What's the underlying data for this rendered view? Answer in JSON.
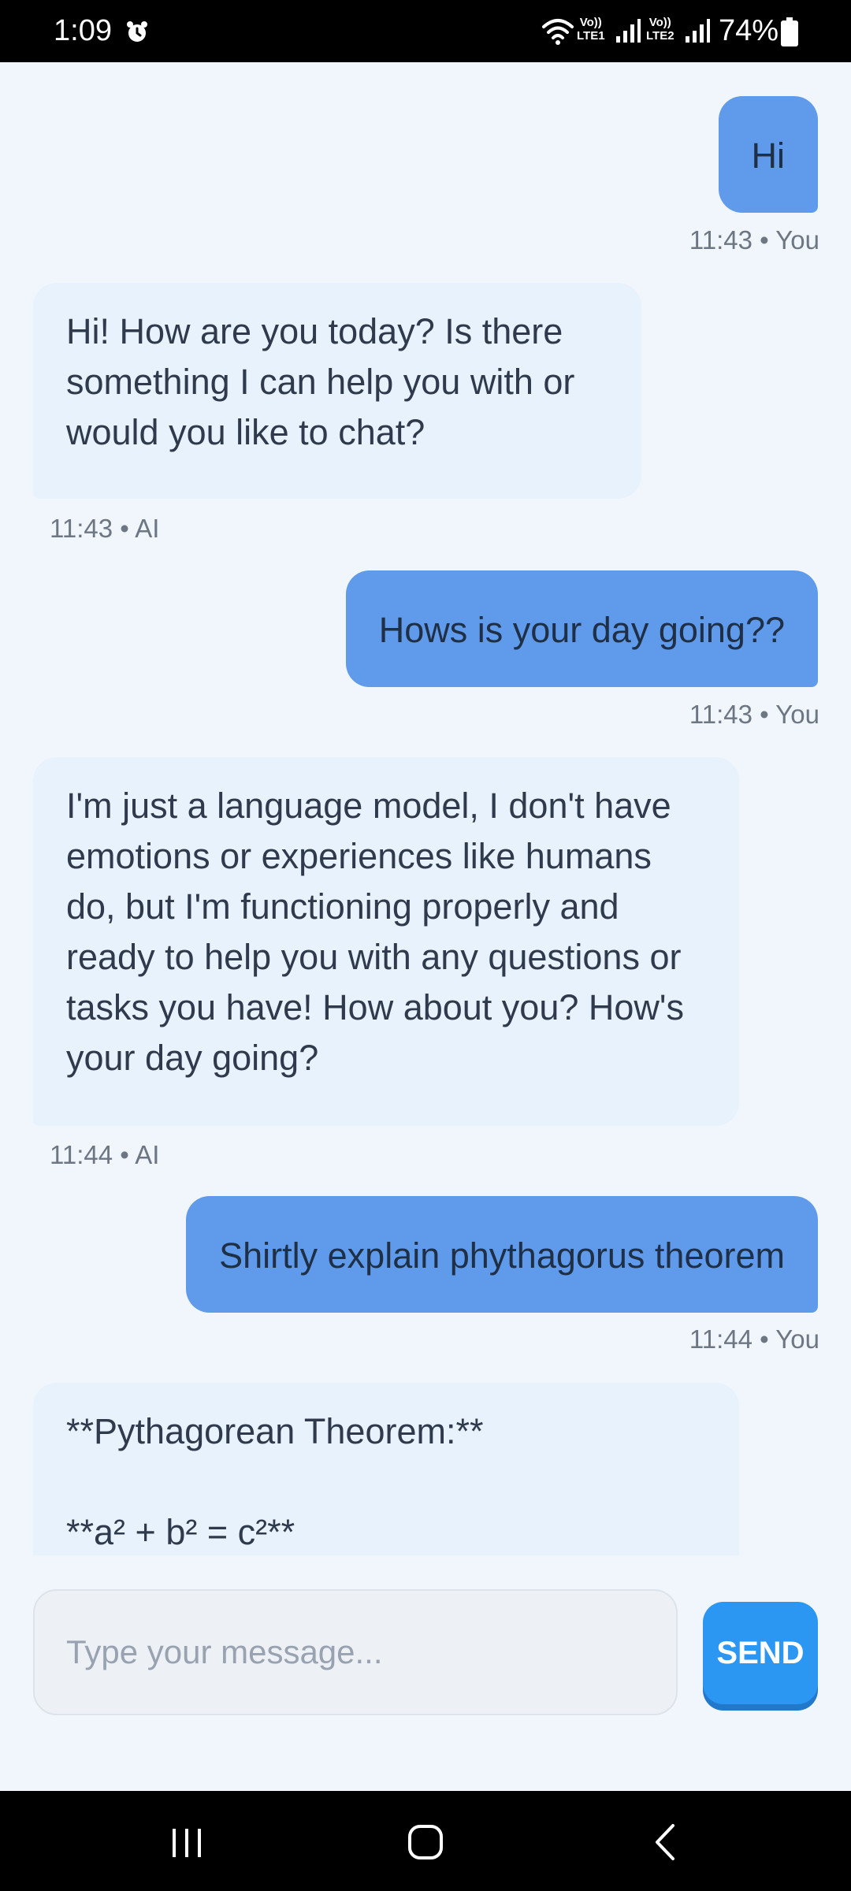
{
  "status_bar": {
    "time": "1:09",
    "network1_top": "Vo))",
    "network1_bottom": "LTE1",
    "network2_top": "Vo))",
    "network2_bottom": "LTE2",
    "battery": "74%"
  },
  "messages": [
    {
      "sender": "user",
      "text": "Hi",
      "meta": "11:43 • You"
    },
    {
      "sender": "ai",
      "text": "Hi! How are you today? Is there something I can help you with or would you like to chat?",
      "meta": "11:43 • AI"
    },
    {
      "sender": "user",
      "text": "Hows is your day going??",
      "meta": "11:43 • You"
    },
    {
      "sender": "ai",
      "text": "I'm just a language model, I don't have emotions or experiences like humans do, but I'm functioning properly and ready to help you with any questions or tasks you have! How about you? How's your day going?",
      "meta": "11:44 • AI"
    },
    {
      "sender": "user",
      "text": "Shirtly explain phythagorus theorem",
      "meta": "11:44 • You"
    },
    {
      "sender": "ai",
      "text_line1": "**Pythagorean Theorem:**",
      "text_line2": "**a² + b² = c²**"
    }
  ],
  "input": {
    "placeholder": "Type your message...",
    "value": ""
  },
  "send_button": {
    "label": "SEND"
  },
  "colors": {
    "user_bubble": "#5f9bea",
    "ai_bubble": "#e8f2fd",
    "send_button": "#2c96f3",
    "background": "#f1f5fc"
  },
  "icons": {
    "alarm": "alarm-icon",
    "wifi": "wifi-icon",
    "signal": "signal-icon",
    "battery": "battery-icon",
    "nav_recent": "recent-apps-icon",
    "nav_home": "home-icon",
    "nav_back": "back-icon"
  }
}
